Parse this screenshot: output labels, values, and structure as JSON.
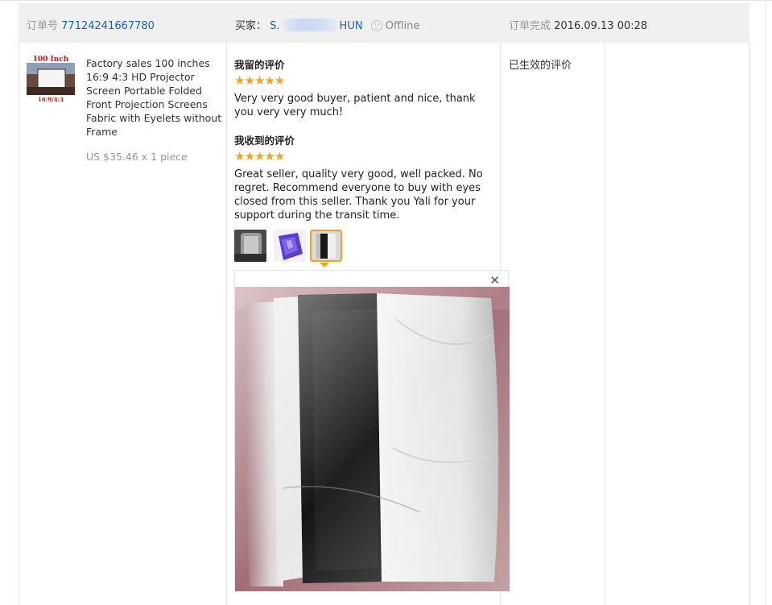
{
  "header": {
    "order_label": "订单号",
    "order_number": "77124241667780",
    "buyer_label": "买家：",
    "buyer_prefix": "S.",
    "buyer_suffix": "HUN",
    "buyer_status": "Offline",
    "completed_label": "订单完成",
    "completed_time": "2016.09.13 00:28"
  },
  "product": {
    "thumb_banner": "100 Inch",
    "thumb_ratio": "16:9/4:3",
    "title": "Factory sales 100 inches 16:9 4:3 HD Projector Screen Portable Folded Front Projection Screens Fabric with Eyelets without Frame",
    "price": "US $35.46 x 1 piece"
  },
  "feedback": {
    "given_heading": "我留的评价",
    "given_stars": "★★★★★",
    "given_text": "Very very good buyer, patient and nice, thank you very very much!",
    "received_heading": "我收到的评价",
    "received_stars": "★★★★★",
    "received_text": "Great seller, quality very good, well packed. No regret. Recommend everyone to buy with eyes closed from this seller. Thank you Yali for your support during the transit time.",
    "photo_count": 3,
    "selected_photo": 3,
    "close_symbol": "✕"
  },
  "status": {
    "effective_label": "已生效的评价"
  },
  "colors": {
    "header_bg": "#f0f0f0",
    "link": "#1a64b5",
    "star": "#f2a321",
    "active_border": "#f2a321"
  }
}
